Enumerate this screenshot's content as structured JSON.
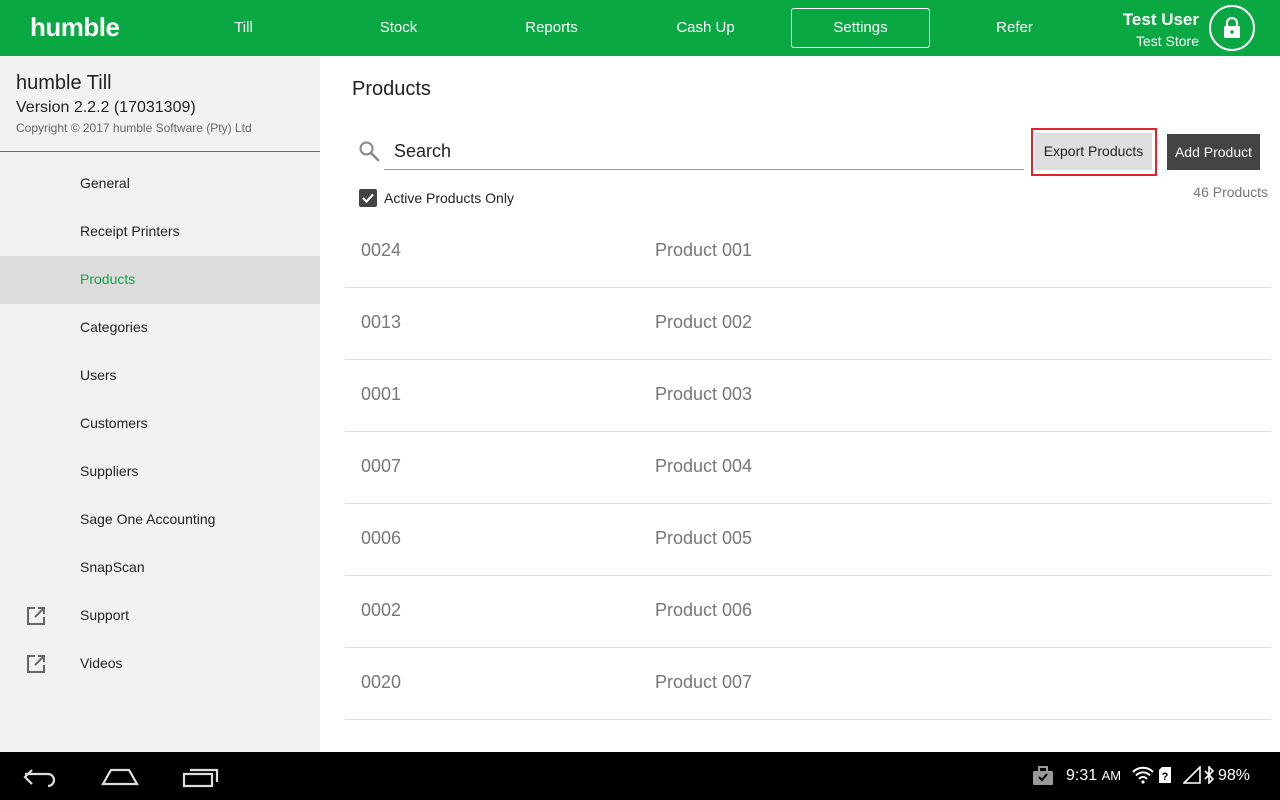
{
  "header": {
    "logo": "humble",
    "nav": [
      {
        "label": "Till",
        "active": false
      },
      {
        "label": "Stock",
        "active": false
      },
      {
        "label": "Reports",
        "active": false
      },
      {
        "label": "Cash Up",
        "active": false
      },
      {
        "label": "Settings",
        "active": true
      },
      {
        "label": "Refer",
        "active": false
      }
    ],
    "user_name": "Test User",
    "store_name": "Test Store",
    "lock_icon": "lock-icon"
  },
  "sidebar": {
    "app_title": "humble Till",
    "version": "Version 2.2.2 (17031309)",
    "copyright": "Copyright © 2017 humble Software (Pty) Ltd",
    "items": [
      {
        "label": "General",
        "active": false,
        "external": false
      },
      {
        "label": "Receipt Printers",
        "active": false,
        "external": false
      },
      {
        "label": "Products",
        "active": true,
        "external": false
      },
      {
        "label": "Categories",
        "active": false,
        "external": false
      },
      {
        "label": "Users",
        "active": false,
        "external": false
      },
      {
        "label": "Customers",
        "active": false,
        "external": false
      },
      {
        "label": "Suppliers",
        "active": false,
        "external": false
      },
      {
        "label": "Sage One Accounting",
        "active": false,
        "external": false
      },
      {
        "label": "SnapScan",
        "active": false,
        "external": false
      },
      {
        "label": "Support",
        "active": false,
        "external": true
      },
      {
        "label": "Videos",
        "active": false,
        "external": true
      }
    ]
  },
  "main": {
    "title": "Products",
    "search_placeholder": "Search",
    "export_label": "Export Products",
    "add_label": "Add Product",
    "active_only_label": "Active Products Only",
    "active_only_checked": true,
    "count_label": "46 Products",
    "products": [
      {
        "code": "0024",
        "name": "Product 001"
      },
      {
        "code": "0013",
        "name": "Product 002"
      },
      {
        "code": "0001",
        "name": "Product 003"
      },
      {
        "code": "0007",
        "name": "Product 004"
      },
      {
        "code": "0006",
        "name": "Product 005"
      },
      {
        "code": "0002",
        "name": "Product 006"
      },
      {
        "code": "0020",
        "name": "Product 007"
      }
    ]
  },
  "system_bar": {
    "time": "9:31",
    "ampm": "AM",
    "battery": "98%"
  },
  "colors": {
    "brand_green": "#0aa842",
    "highlight_red": "#e0242e",
    "add_button": "#444444"
  }
}
